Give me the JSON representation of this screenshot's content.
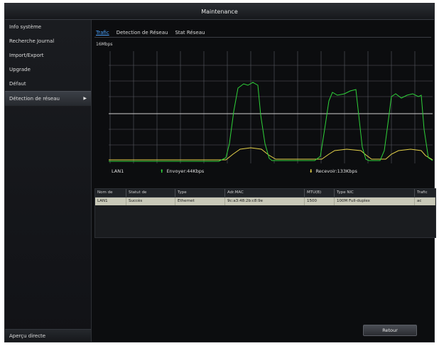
{
  "window": {
    "title": "Maintenance"
  },
  "sidebar": {
    "items": [
      {
        "label": "Info système"
      },
      {
        "label": "Recherche Journal"
      },
      {
        "label": "Import/Export"
      },
      {
        "label": "Upgrade"
      },
      {
        "label": "Défaut"
      },
      {
        "label": "Détection de réseau",
        "arrow": "▶"
      }
    ],
    "live_view": "Aperçu directe"
  },
  "tabs": [
    "Trafic",
    "Detection de Réseau",
    "Stat Réseau"
  ],
  "graph": {
    "unit_label": "16Mbps",
    "lan_label": "LAN1",
    "send_label": "Envoyer:44Kbps",
    "receive_label": "Recevoir:133Kbps",
    "send_color": "#2fd23a",
    "receive_color": "#e5d24a"
  },
  "table": {
    "headers": [
      "Nom de",
      "Statut de",
      "Type",
      "Adr.MAC",
      "MTU(B)",
      "Type NIC",
      "Trafic"
    ],
    "rows": [
      [
        "LAN1",
        "Succès",
        "Ethernet",
        "9c:a3:48:2b:c8:9e",
        "1500",
        "100M Full-duplex",
        "ac"
      ]
    ]
  },
  "buttons": {
    "back": "Retour"
  }
}
